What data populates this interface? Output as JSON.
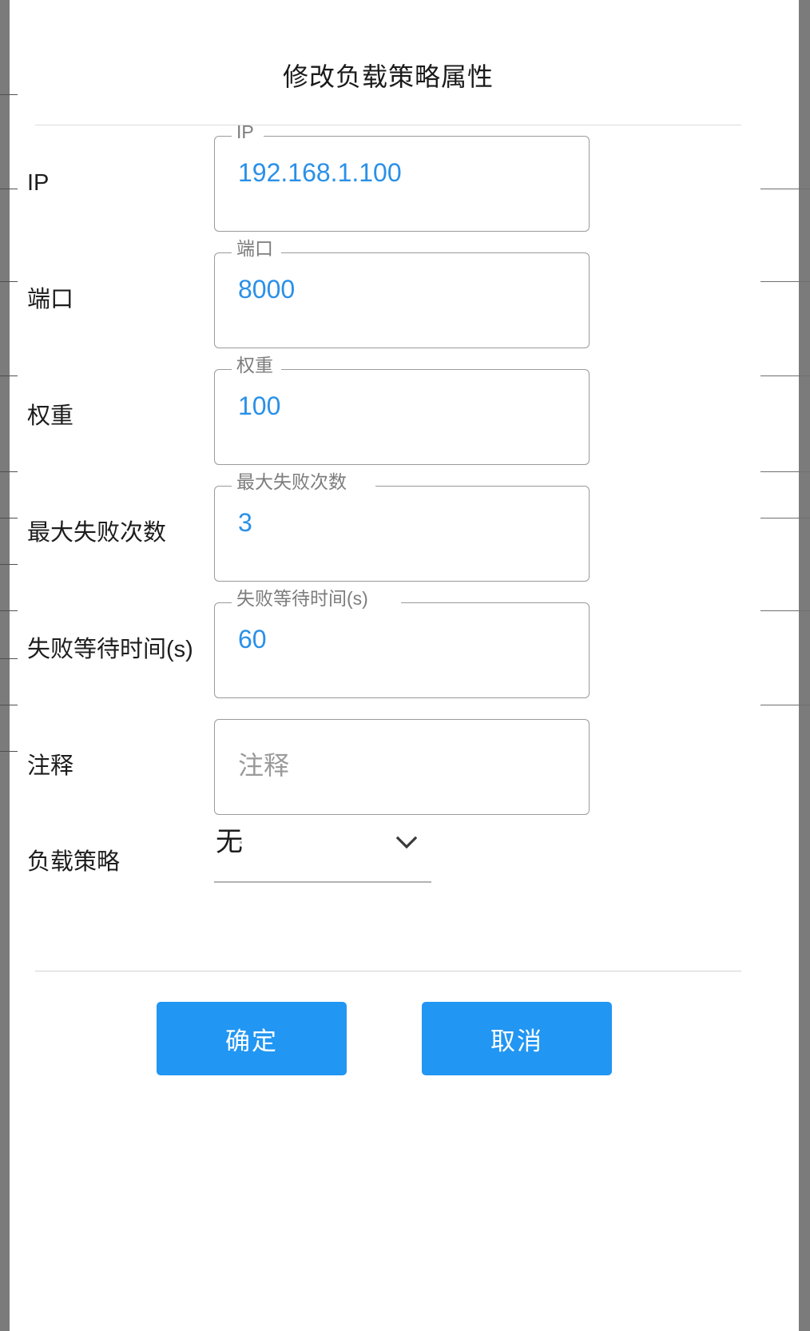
{
  "dialog": {
    "title": "修改负载策略属性"
  },
  "fields": [
    {
      "label": "IP",
      "legend": "IP",
      "value": "192.168.1.100",
      "notch_width": 40,
      "name": "ip"
    },
    {
      "label": "端口",
      "legend": "端口",
      "value": "8000",
      "notch_width": 62,
      "name": "port"
    },
    {
      "label": "权重",
      "legend": "权重",
      "value": "100",
      "notch_width": 62,
      "name": "weight"
    },
    {
      "label": "最大失败次数",
      "legend": "最大失败次数",
      "value": "3",
      "notch_width": 180,
      "name": "max-fails"
    },
    {
      "label": "失败等待时间(s)",
      "legend": "失败等待时间(s)",
      "value": "60",
      "notch_width": 212,
      "name": "fail-timeout"
    }
  ],
  "comment_field": {
    "label": "注释",
    "placeholder": "注释",
    "value": ""
  },
  "select_field": {
    "label": "负载策略",
    "value": "无",
    "icon": "chevron-down-icon"
  },
  "buttons": {
    "ok": "确定",
    "cancel": "取消"
  },
  "colors": {
    "accent": "#2196f3",
    "value_text": "#2a90e8",
    "legend_text": "#7d7d7d",
    "outline": "#9a9a9a",
    "backdrop": "#7b7b7b"
  }
}
